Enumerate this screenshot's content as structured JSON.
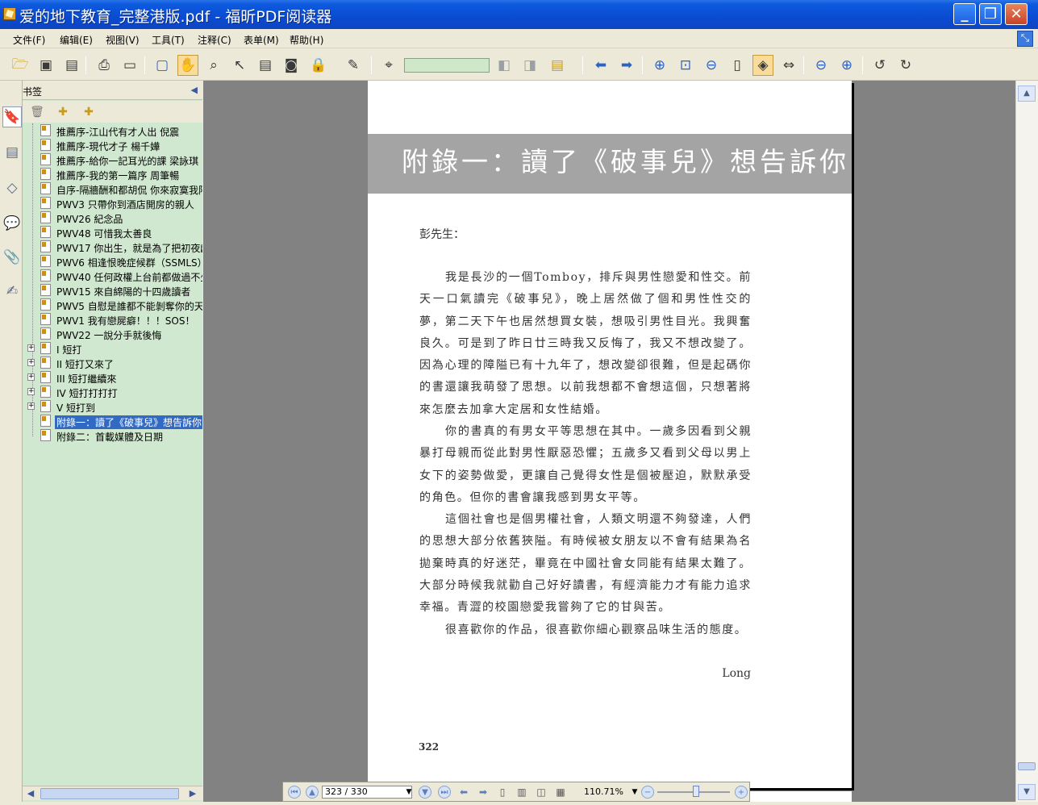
{
  "window": {
    "title": "爱的地下教育_完整港版.pdf - 福昕PDF阅读器"
  },
  "menu": [
    "文件(F)",
    "编辑(E)",
    "视图(V)",
    "工具(T)",
    "注释(C)",
    "表单(M)",
    "帮助(H)"
  ],
  "bookmarks": {
    "title": "书签",
    "items": [
      {
        "label": "推薦序-江山代有才人出 倪震"
      },
      {
        "label": "推薦序-現代才子 楊千嬅"
      },
      {
        "label": "推薦序-給你一記耳光的課 梁詠琪"
      },
      {
        "label": "推薦序-我的第一篇序 周筆暢"
      },
      {
        "label": "自序-隔牆酬和都胡侃 你來寂寞我陪"
      },
      {
        "label": "PWV3 只帶你到酒店開房的親人"
      },
      {
        "label": "PWV26 紀念品"
      },
      {
        "label": "PWV48 可惜我太善良"
      },
      {
        "label": "PWV17 你出生，就是為了把初夜獻"
      },
      {
        "label": "PWV6 相逢恨晚症候群（SSMLS）"
      },
      {
        "label": "PWV40 任何政權上台前都做過不少"
      },
      {
        "label": "PWV15 來自綿陽的十四歲讀者"
      },
      {
        "label": "PWV5 自慰是誰都不能剝奪你的天"
      },
      {
        "label": "PWV1 我有戀屍癖！！！SOS！"
      },
      {
        "label": "PWV22 一說分手就後悔"
      },
      {
        "label": "I 短打"
      },
      {
        "label": "II 短打又來了"
      },
      {
        "label": "III 短打繼續來"
      },
      {
        "label": "IV 短打打打打"
      },
      {
        "label": "V 短打到"
      },
      {
        "label": "附錄一：讀了《破事兒》想告訴你"
      },
      {
        "label": "附錄二：首載媒體及日期"
      }
    ]
  },
  "document": {
    "chapter_title": "附錄一：讀了《破事兒》想告訴你",
    "salutation": "彭先生：",
    "paragraphs": [
      "我是長沙的一個Tomboy，排斥與男性戀愛和性交。前天一口氣讀完《破事兒》，晚上居然做了個和男性性交的夢，第二天下午也居然想買女裝，想吸引男性目光。我興奮良久。可是到了昨日廿三時我又反悔了，我又不想改變了。因為心理的障隘已有十九年了，想改變卻很難，但是起碼你的書還讓我萌發了思想。以前我想都不會想這個，只想著將來怎麼去加拿大定居和女性結婚。",
      "你的書真的有男女平等思想在其中。一歲多因看到父親暴打母親而從此對男性厭惡恐懼；五歲多又看到父母以男上女下的姿勢做愛，更讓自己覺得女性是個被壓迫，默默承受的角色。但你的書會讓我感到男女平等。",
      "這個社會也是個男權社會，人類文明還不夠發達，人們的思想大部分依舊狹隘。有時候被女朋友以不會有結果為名拋棄時真的好迷茫，畢竟在中國社會女同能有結果太難了。大部分時候我就勸自己好好讀書，有經濟能力才有能力追求幸福。青澀的校園戀愛我嘗夠了它的甘與苦。",
      "很喜歡你的作品，很喜歡你細心觀察品味生活的態度。"
    ],
    "signature": "Long",
    "page_number": "322"
  },
  "navigation": {
    "page_field": "323 / 330",
    "zoom": "110.71%"
  }
}
